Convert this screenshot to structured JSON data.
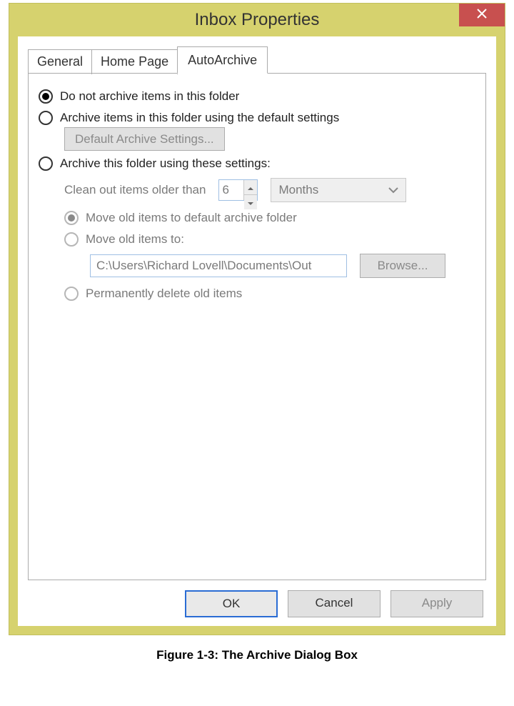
{
  "dialog": {
    "title": "Inbox Properties",
    "tabs": {
      "general": "General",
      "homepage": "Home Page",
      "autoarchive": "AutoArchive"
    },
    "options": {
      "noarchive": "Do not archive items in this folder",
      "default": "Archive items in this folder using the default settings",
      "default_btn": "Default Archive Settings...",
      "custom": "Archive this folder using these settings:",
      "clean_label": "Clean out items older than",
      "age_value": "6",
      "unit_selected": "Months",
      "move_default": "Move old items to default archive folder",
      "move_to": "Move old items to:",
      "path": "C:\\Users\\Richard Lovell\\Documents\\Out",
      "browse": "Browse...",
      "delete": "Permanently delete old items"
    },
    "footer": {
      "ok": "OK",
      "cancel": "Cancel",
      "apply": "Apply"
    }
  },
  "caption": "Figure 1-3: The Archive Dialog Box"
}
